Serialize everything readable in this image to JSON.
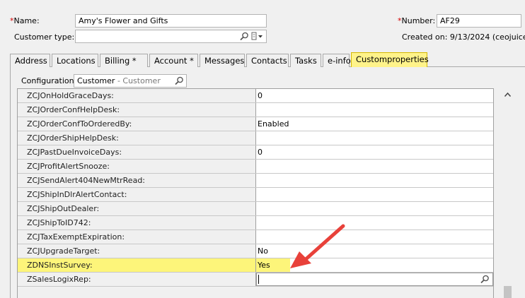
{
  "header": {
    "name_label": "Name:",
    "name_value": "Amy's Flower and Gifts",
    "customer_type_label": "Customer type:",
    "customer_type_value": "",
    "number_label": "Number:",
    "number_value": "AF29",
    "created_text": "Created on: 9/13/2024 (ceojuice)"
  },
  "tabs": [
    {
      "label": "Address"
    },
    {
      "label": "Locations"
    },
    {
      "label": "Billing *"
    },
    {
      "label": "Account *"
    },
    {
      "label": "Messages"
    },
    {
      "label": "Contacts"
    },
    {
      "label": "Tasks"
    },
    {
      "label": "e-info"
    },
    {
      "label": "Customproperties"
    }
  ],
  "config": {
    "label": "Configuration:",
    "value": "Customer",
    "sub_value": "- Customer"
  },
  "properties": [
    {
      "name": "ZCJOnHoldGraceDays:",
      "value": "0"
    },
    {
      "name": "ZCJOrderConfHelpDesk:",
      "value": ""
    },
    {
      "name": "ZCJOrderConfToOrderedBy:",
      "value": "Enabled"
    },
    {
      "name": "ZCJOrderShipHelpDesk:",
      "value": ""
    },
    {
      "name": "ZCJPastDueInvoiceDays:",
      "value": "0"
    },
    {
      "name": "ZCJProfitAlertSnooze:",
      "value": ""
    },
    {
      "name": "ZCJSendAlert404NewMtrRead:",
      "value": ""
    },
    {
      "name": "ZCJShipInDlrAlertContact:",
      "value": ""
    },
    {
      "name": "ZCJShipOutDealer:",
      "value": ""
    },
    {
      "name": "ZCJShipToID742:",
      "value": ""
    },
    {
      "name": "ZCJTaxExemptExpiration:",
      "value": ""
    },
    {
      "name": "ZCJUpgradeTarget:",
      "value": "No"
    },
    {
      "name": "ZDNSInstSurvey:",
      "value": "Yes"
    },
    {
      "name": "ZSalesLogixRep:",
      "value": ""
    }
  ],
  "icons": {
    "search": "magnifier-icon",
    "dropdown": "dropdown-icon",
    "scroll_up": "scroll-up-arrow-icon",
    "annotation": "red-arrow-annotation"
  },
  "colors": {
    "highlight": "#fdf57a",
    "active_tab": "#fff38a",
    "arrow": "#e8413a",
    "required": "#d40000"
  }
}
